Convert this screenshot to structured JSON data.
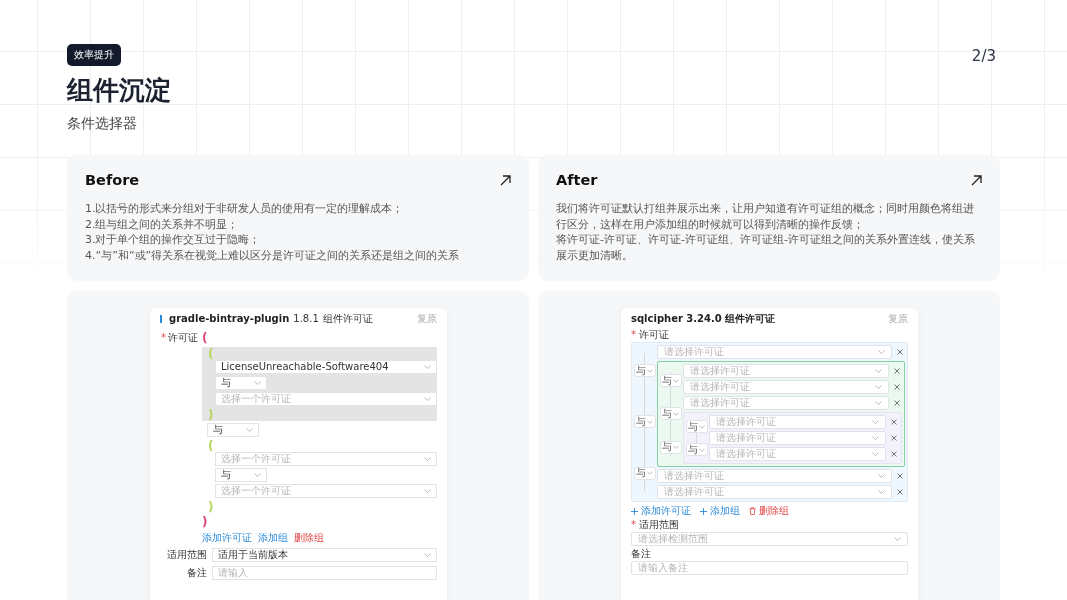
{
  "header": {
    "badge": "效率提升",
    "title": "组件沉淀",
    "subtitle": "条件选择器",
    "page_indicator": "2/3"
  },
  "cards": [
    {
      "title": "Before",
      "paragraphs": [
        "1.以括号的形式来分组对于非研发人员的使用有一定的理解成本；",
        "2.组与组之间的关系并不明显；",
        "3.对于单个组的操作交互过于隐晦；",
        "4.“与”和“或”得关系在视觉上难以区分是许可证之间的关系还是组之间的关系"
      ]
    },
    {
      "title": "After",
      "paragraphs": [
        "我们将许可证默认打组并展示出来，让用户知道有许可证组的概念；同时用颜色将组进行区分，这样在用户添加组的时候就可以得到清晰的操作反馈；",
        "将许可证-许可证、许可证-许可证组、许可证组-许可证组之间的关系外置连线，使关系展示更加清晰。"
      ]
    }
  ],
  "before_form": {
    "name": "gradle-bintray-plugin",
    "version": "1.8.1",
    "title": "组件许可证",
    "reset": "复原",
    "required_mark": "*",
    "license_label": "许可证",
    "open": "(",
    "close": ")",
    "color": "#e0407a",
    "children": [
      {
        "kind": "group",
        "highlighted": true,
        "open": "(",
        "close": ")",
        "color": "#b5d65e",
        "children": [
          {
            "kind": "select",
            "value": "LicenseUnreachable-Software404"
          },
          {
            "kind": "operator",
            "value": "与"
          },
          {
            "kind": "select",
            "placeholder": "选择一个许可证"
          }
        ]
      },
      {
        "kind": "operator",
        "value": "与"
      },
      {
        "kind": "group",
        "highlighted": false,
        "open": "(",
        "close": ")",
        "color": "#b5d65e",
        "children": [
          {
            "kind": "select",
            "placeholder": "选择一个许可证"
          },
          {
            "kind": "operator",
            "value": "与"
          },
          {
            "kind": "select",
            "placeholder": "选择一个许可证"
          }
        ]
      }
    ],
    "actions": [
      {
        "kind": "add",
        "label": "添加许可证"
      },
      {
        "kind": "add",
        "label": "添加组"
      },
      {
        "kind": "delete",
        "label": "删除组"
      }
    ],
    "fields": [
      {
        "label": "适用范围",
        "value": "适用于当前版本"
      },
      {
        "label": "备注",
        "placeholder": "请输入"
      }
    ]
  },
  "after_form": {
    "title": "sqlcipher 3.24.0  组件许可证",
    "reset": "复原",
    "required_mark": "*",
    "license_label": "许可证",
    "tree": {
      "color": "#eef6fe",
      "outlined": false,
      "operators": [
        "与",
        "与",
        "与"
      ],
      "children": [
        {
          "kind": "select",
          "placeholder": "请选择许可证"
        },
        {
          "kind": "group",
          "color": "#ebf9f0",
          "outlined": true,
          "operators": [
            "与",
            "与",
            "与"
          ],
          "children": [
            {
              "kind": "select",
              "placeholder": "请选择许可证"
            },
            {
              "kind": "select",
              "placeholder": "请选择许可证"
            },
            {
              "kind": "select",
              "placeholder": "请选择许可证"
            },
            {
              "kind": "group",
              "color": "#f3f1fc",
              "outlined": false,
              "operators": [
                "与",
                "与"
              ],
              "children": [
                {
                  "kind": "select",
                  "placeholder": "请选择许可证"
                },
                {
                  "kind": "select",
                  "placeholder": "请选择许可证"
                },
                {
                  "kind": "select",
                  "placeholder": "请选择许可证"
                }
              ]
            }
          ]
        },
        {
          "kind": "select",
          "placeholder": "请选择许可证"
        },
        {
          "kind": "select",
          "placeholder": "请选择许可证"
        }
      ]
    },
    "actions": [
      {
        "kind": "add",
        "label": "添加许可证"
      },
      {
        "kind": "add",
        "label": "添加组"
      },
      {
        "kind": "delete",
        "label": "删除组"
      }
    ],
    "fields": [
      {
        "label": "适用范围",
        "required_mark": "*",
        "placeholder": "请选择检测范围"
      },
      {
        "label": "备注",
        "placeholder": "请输入备注"
      }
    ]
  }
}
